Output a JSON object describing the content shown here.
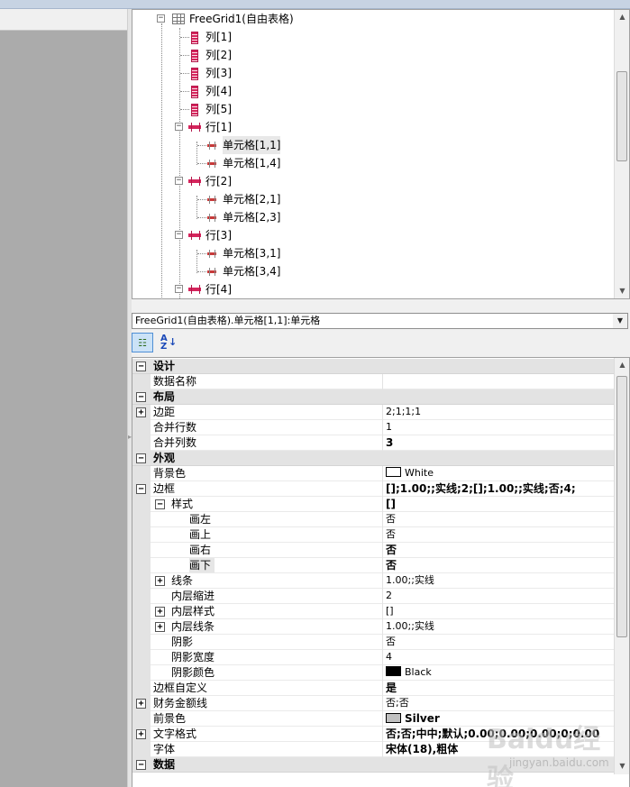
{
  "tree": {
    "root_label": "FreeGrid1(自由表格)",
    "columns": [
      "列[1]",
      "列[2]",
      "列[3]",
      "列[4]",
      "列[5]"
    ],
    "rows": [
      {
        "label": "行[1]",
        "cells": [
          "单元格[1,1]",
          "单元格[1,4]"
        ]
      },
      {
        "label": "行[2]",
        "cells": [
          "单元格[2,1]",
          "单元格[2,3]"
        ]
      },
      {
        "label": "行[3]",
        "cells": [
          "单元格[3,1]",
          "单元格[3,4]"
        ]
      },
      {
        "label": "行[4]",
        "cells": []
      }
    ],
    "selected": "单元格[1,1]"
  },
  "object_selector": {
    "value": "FreeGrid1(自由表格).单元格[1,1]:单元格"
  },
  "toolbar": {
    "categorized_icon": "categorized-view-icon",
    "alphabetical_icon": "sort-az-icon",
    "alpha_top": "A",
    "alpha_bottom": "Z"
  },
  "properties": {
    "design": {
      "label": "设计"
    },
    "data_name": {
      "label": "数据名称",
      "value": ""
    },
    "layout": {
      "label": "布局"
    },
    "margin": {
      "label": "边距",
      "value": "2;1;1;1"
    },
    "merge_rows": {
      "label": "合并行数",
      "value": "1"
    },
    "merge_cols": {
      "label": "合并列数",
      "value": "3"
    },
    "appearance": {
      "label": "外观"
    },
    "bg_color": {
      "label": "背景色",
      "value": "White",
      "swatch": "#ffffff"
    },
    "border": {
      "label": "边框",
      "value": "[];1.00;;实线;2;[];1.00;;实线;否;4;"
    },
    "style": {
      "label": "样式",
      "value": "[]"
    },
    "draw_left": {
      "label": "画左",
      "value": "否"
    },
    "draw_top": {
      "label": "画上",
      "value": "否"
    },
    "draw_right": {
      "label": "画右",
      "value": "否"
    },
    "draw_bottom": {
      "label": "画下",
      "value": "否"
    },
    "line": {
      "label": "线条",
      "value": "1.00;;实线"
    },
    "inner_indent": {
      "label": "内层缩进",
      "value": "2"
    },
    "inner_style": {
      "label": "内层样式",
      "value": "[]"
    },
    "inner_line": {
      "label": "内层线条",
      "value": "1.00;;实线"
    },
    "shadow": {
      "label": "阴影",
      "value": "否"
    },
    "shadow_width": {
      "label": "阴影宽度",
      "value": "4"
    },
    "shadow_color": {
      "label": "阴影颜色",
      "value": "Black",
      "swatch": "#000000"
    },
    "border_custom": {
      "label": "边框自定义",
      "value": "是"
    },
    "finance_line": {
      "label": "财务金额线",
      "value": "否;否"
    },
    "fg_color": {
      "label": "前景色",
      "value": "Silver",
      "swatch": "#c0c0c0"
    },
    "text_format": {
      "label": "文字格式",
      "value": "否;否;中中;默认;0.00;0.00;0.00;0;0.00"
    },
    "font": {
      "label": "字体",
      "value": "宋体(18),粗体"
    },
    "data": {
      "label": "数据"
    }
  },
  "watermark": {
    "logo": "Baidu经验",
    "url": "jingyan.baidu.com"
  }
}
